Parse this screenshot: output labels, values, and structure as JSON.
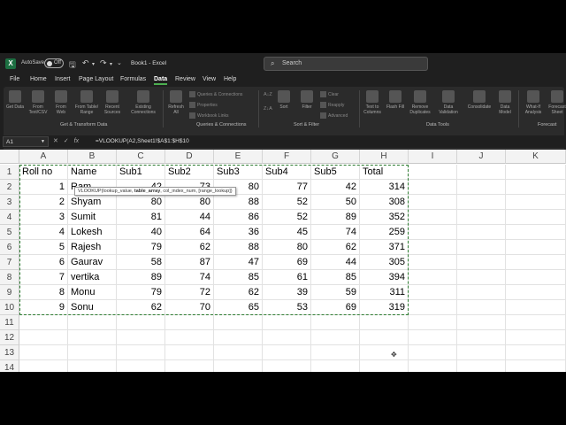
{
  "title": {
    "autosave_label": "AutoSave",
    "autosave_state": "Off",
    "document": "Book1 - Excel",
    "search_placeholder": "Search"
  },
  "tabs": [
    {
      "label": "File"
    },
    {
      "label": "Home"
    },
    {
      "label": "Insert"
    },
    {
      "label": "Page Layout"
    },
    {
      "label": "Formulas"
    },
    {
      "label": "Data",
      "active": true
    },
    {
      "label": "Review"
    },
    {
      "label": "View"
    },
    {
      "label": "Help"
    }
  ],
  "ribbon": {
    "get_transform": {
      "buttons": [
        "Get Data",
        "From Text/CSV",
        "From Web",
        "From Table/ Range",
        "Recent Sources",
        "Existing Connections"
      ],
      "label": "Get & Transform Data"
    },
    "queries": {
      "refresh": "Refresh All",
      "items": [
        "Queries & Connections",
        "Properties",
        "Workbook Links"
      ],
      "label": "Queries & Connections"
    },
    "sort_filter": {
      "sort_az": "A↓Z",
      "sort_za": "Z↓A",
      "sort": "Sort",
      "filter": "Filter",
      "items": [
        "Clear",
        "Reapply",
        "Advanced"
      ],
      "label": "Sort & Filter"
    },
    "data_tools": {
      "buttons": [
        "Text to Columns",
        "Flash Fill",
        "Remove Duplicates",
        "Data Validation",
        "Consolidate",
        "Data Model"
      ],
      "label": "Data Tools"
    },
    "forecast": {
      "buttons": [
        "What-If Analysis",
        "Forecast Sheet"
      ],
      "label": "Forecast"
    }
  },
  "formula_bar": {
    "name_box": "A1",
    "fx": "fx",
    "formula": "=VLOOKUP(A2,Sheet1!$A$1:$H$10"
  },
  "tooltip": {
    "prefix": "VLOOKUP(lookup_value, ",
    "bold": "table_array",
    "suffix": ", col_index_num, [range_lookup])"
  },
  "grid": {
    "columns": [
      "A",
      "B",
      "C",
      "D",
      "E",
      "F",
      "G",
      "H",
      "I",
      "J",
      "K"
    ],
    "row_numbers": [
      "1",
      "2",
      "3",
      "4",
      "5",
      "6",
      "7",
      "8",
      "9",
      "10",
      "11",
      "12",
      "13",
      "14"
    ],
    "header_row": [
      "Roll no",
      "Name",
      "Sub1",
      "Sub2",
      "Sub3",
      "Sub4",
      "Sub5",
      "Total"
    ],
    "rows": [
      [
        "1",
        "Ram",
        "42",
        "73",
        "80",
        "77",
        "42",
        "314"
      ],
      [
        "2",
        "Shyam",
        "80",
        "80",
        "88",
        "52",
        "50",
        "308"
      ],
      [
        "3",
        "Sumit",
        "81",
        "44",
        "86",
        "52",
        "89",
        "352"
      ],
      [
        "4",
        "Lokesh",
        "40",
        "64",
        "36",
        "45",
        "74",
        "259"
      ],
      [
        "5",
        "Rajesh",
        "79",
        "62",
        "88",
        "80",
        "62",
        "371"
      ],
      [
        "6",
        "Gaurav",
        "58",
        "87",
        "47",
        "69",
        "44",
        "305"
      ],
      [
        "7",
        "vertika",
        "89",
        "74",
        "85",
        "61",
        "85",
        "394"
      ],
      [
        "8",
        "Monu",
        "79",
        "72",
        "62",
        "39",
        "59",
        "311"
      ],
      [
        "9",
        "Sonu",
        "62",
        "70",
        "65",
        "53",
        "69",
        "319"
      ]
    ]
  }
}
